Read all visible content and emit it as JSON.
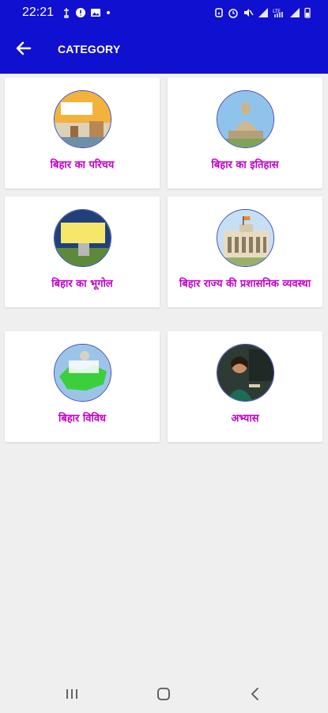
{
  "status_bar": {
    "time": "22:21",
    "left_icons": [
      "usb-icon",
      "alert-icon",
      "image-icon",
      "dot-icon"
    ],
    "right_icons": [
      "alarm-icon",
      "lock-icon",
      "mute-icon",
      "signal-icon",
      "lte-icon",
      "signal-icon",
      "battery-icon"
    ]
  },
  "header": {
    "title": "CATEGORY",
    "back_icon": "arrow-left-icon"
  },
  "categories": [
    {
      "label": "बिहार का परिचय",
      "image": "bihar-intro-thumb"
    },
    {
      "label": "बिहार का इतिहास",
      "image": "buddha-statue-thumb"
    },
    {
      "label": "बिहार का भूगोल",
      "image": "bihar-geography-thumb"
    },
    {
      "label": "बिहार राज्य की प्रशासनिक व्यवस्था",
      "image": "administration-building-thumb"
    },
    {
      "label": "बिहार विविध",
      "image": "bihar-map-vividh-thumb"
    },
    {
      "label": "अभ्यास",
      "image": "teacher-thumb"
    }
  ],
  "colors": {
    "primary": "#1010d0",
    "label": "#c000c8",
    "background": "#efefef",
    "card": "#ffffff"
  },
  "nav_bar": [
    "recents-icon",
    "home-icon",
    "back-icon"
  ]
}
